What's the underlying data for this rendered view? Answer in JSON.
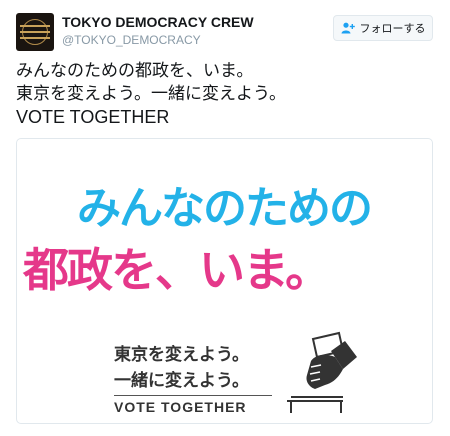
{
  "account": {
    "name": "TOKYO DEMOCRACY CREW",
    "handle": "@TOKYO_DEMOCRACY"
  },
  "follow_button": {
    "label": "フォローする",
    "icon": "add-user-icon"
  },
  "tweet": {
    "lines": [
      "みんなのための都政を、いま。",
      "東京を変えよう。一緒に変えよう。",
      "VOTE TOGETHER"
    ]
  },
  "media": {
    "headline_line1": "みんなのための",
    "headline_line2": "都政を、いま。",
    "slogan_line1": "東京を変えよう。",
    "slogan_line2": "一緒に変えよう。",
    "vote_text": "VOTE TOGETHER",
    "colors": {
      "headline_blue": "#23b2e8",
      "headline_pink": "#e5388a"
    },
    "illustration": "hand-casting-ballot-icon"
  }
}
